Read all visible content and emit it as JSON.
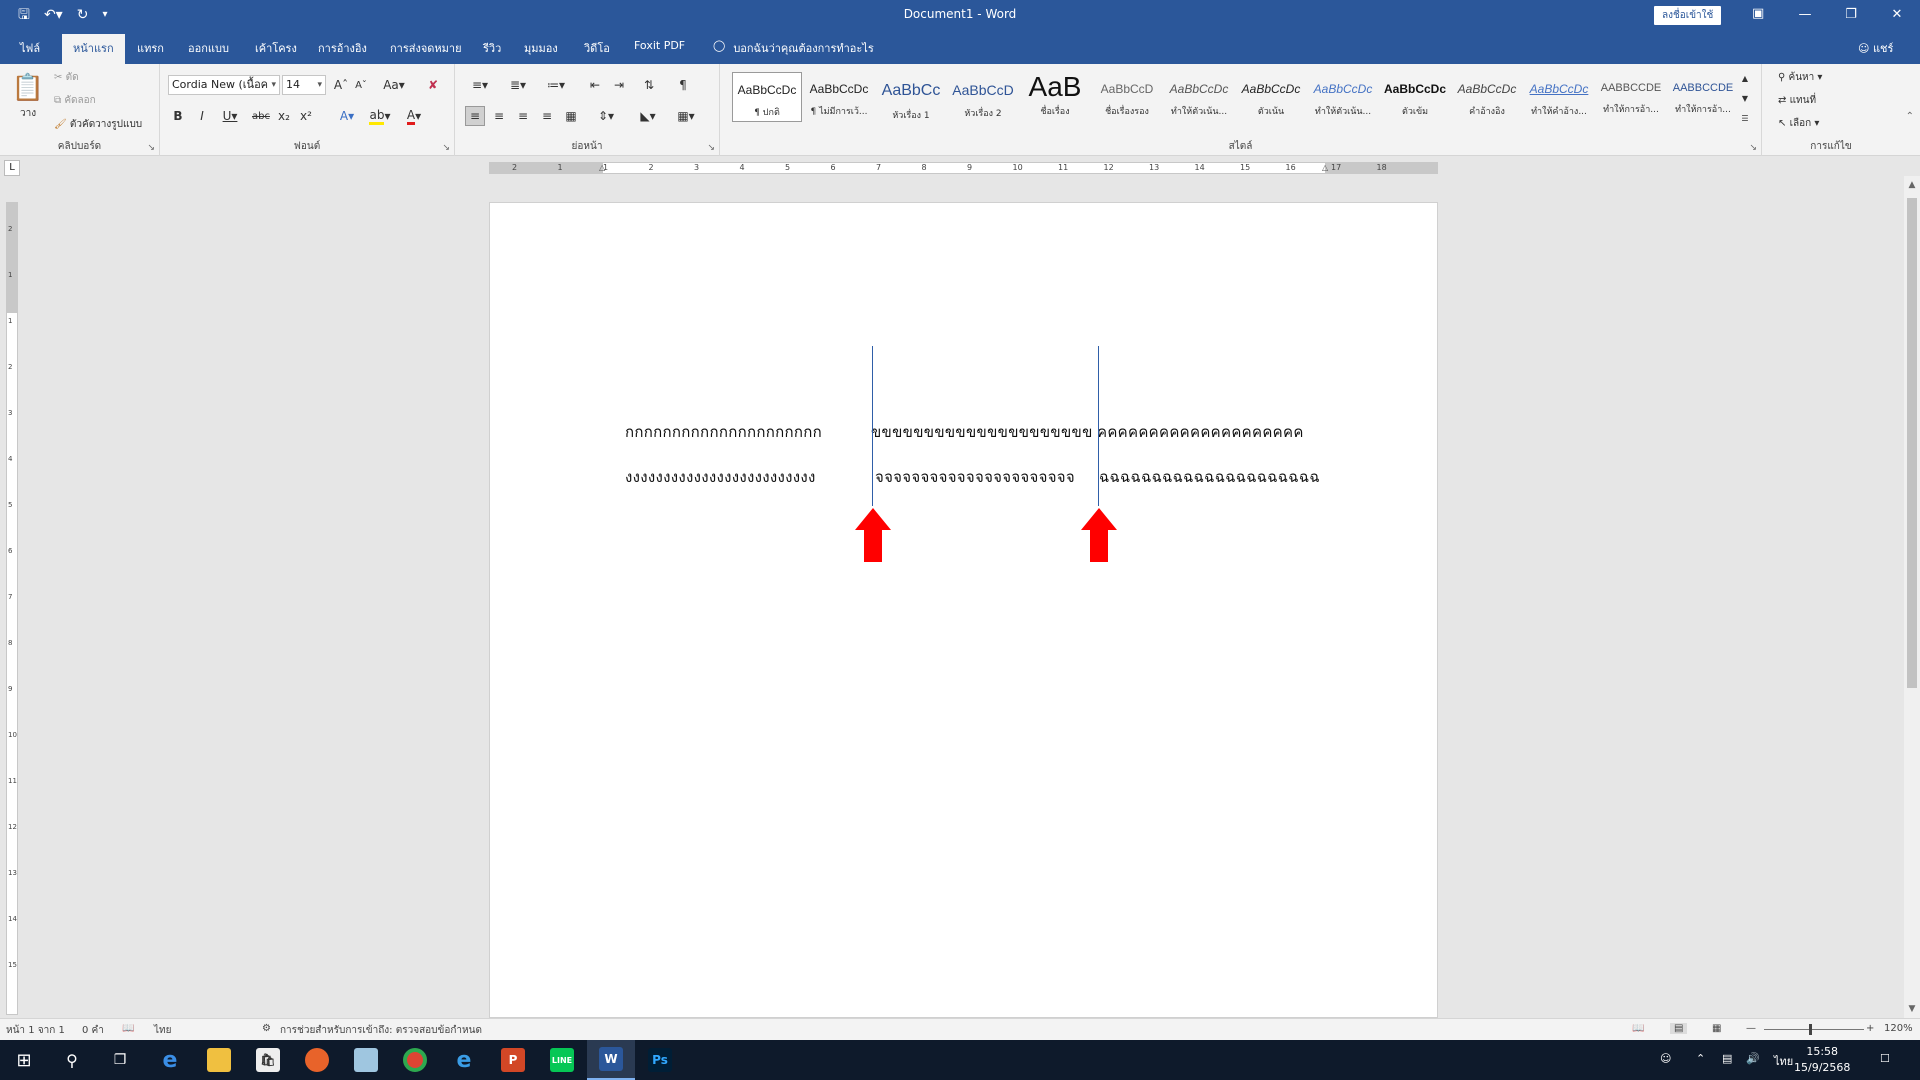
{
  "titlebar": {
    "title": "Document1 - Word",
    "signin": "ลงชื่อเข้าใช้",
    "qat": [
      "save-icon",
      "undo-icon",
      "redo-icon",
      "customize-icon"
    ]
  },
  "tabs": {
    "file": "ไฟล์",
    "home": "หน้าแรก",
    "insert": "แทรก",
    "design": "ออกแบบ",
    "layout": "เค้าโครง",
    "references": "การอ้างอิง",
    "mailings": "การส่งจดหมาย",
    "review": "รีวิว",
    "view": "มุมมอง",
    "video": "วิดีโอ",
    "foxit": "Foxit PDF",
    "tell_me": "บอกฉันว่าคุณต้องการทำอะไร",
    "share": "แชร์"
  },
  "ribbon": {
    "clipboard": {
      "label": "คลิปบอร์ด",
      "paste": "วาง",
      "cut": "ตัด",
      "copy": "คัดลอก",
      "format_painter": "ตัวคัดวางรูปแบบ"
    },
    "font": {
      "label": "ฟอนต์",
      "font_name": "Cordia New (เนื้อค",
      "font_size": "14"
    },
    "paragraph": {
      "label": "ย่อหน้า"
    },
    "styles": {
      "label": "สไตล์",
      "items": [
        {
          "preview": "AaBbCcDc",
          "name": "¶ ปกติ"
        },
        {
          "preview": "AaBbCcDc",
          "name": "¶ ไม่มีการเว้..."
        },
        {
          "preview": "AaBbCc",
          "name": "หัวเรื่อง 1"
        },
        {
          "preview": "AaBbCcD",
          "name": "หัวเรื่อง 2"
        },
        {
          "preview": "AaB",
          "name": "ชื่อเรื่อง"
        },
        {
          "preview": "AaBbCcD",
          "name": "ชื่อเรื่องรอง"
        },
        {
          "preview": "AaBbCcDc",
          "name": "ทำให้ตัวเน้น..."
        },
        {
          "preview": "AaBbCcDc",
          "name": "ตัวเน้น"
        },
        {
          "preview": "AaBbCcDc",
          "name": "ทำให้ตัวเน้น..."
        },
        {
          "preview": "AaBbCcDc",
          "name": "ตัวเข้ม"
        },
        {
          "preview": "AaBbCcDc",
          "name": "คำอ้างอิง"
        },
        {
          "preview": "AaBbCcDc",
          "name": "ทำให้คำอ้าง..."
        },
        {
          "preview": "AABBCCDE",
          "name": "ทำให้การอ้า..."
        },
        {
          "preview": "AABBCCDE",
          "name": "ทำให้การอ้า..."
        }
      ]
    },
    "editing": {
      "label": "การแก้ไข",
      "find": "ค้นหา",
      "replace": "แทนที่",
      "select": "เลือก"
    }
  },
  "document": {
    "line1": [
      "กกกกกกกกกกกกกกกกกกกกก",
      "ขขขขขขขขขขขขขขขขขขขขข",
      "คคคคคคคคคคคคคคคคคคคค"
    ],
    "line2": [
      "งงงงงงงงงงงงงงงงงงงงงงงงง",
      "จจจจจจจจจจจจจจจจจจจจจจ",
      "ฉฉฉฉฉฉฉฉฉฉฉฉฉฉฉฉฉฉฉฉฉ"
    ],
    "arrow_color": "#ff0000",
    "tab_line_color": "#2f5ea8"
  },
  "ruler": {
    "h_numbers": [
      "2",
      "1",
      "1",
      "2",
      "3",
      "4",
      "5",
      "6",
      "7",
      "8",
      "9",
      "10",
      "11",
      "12",
      "13",
      "14",
      "15",
      "16",
      "17",
      "18"
    ],
    "v_numbers": [
      "2",
      "1",
      "1",
      "2",
      "3",
      "4",
      "5",
      "6",
      "7",
      "8",
      "9",
      "10",
      "11",
      "12",
      "13",
      "14",
      "15"
    ]
  },
  "statusbar": {
    "page": "หน้า 1 จาก 1",
    "words": "0 คำ",
    "language": "ไทย",
    "accessibility": "การช่วยสำหรับการเข้าถึง: ตรวจสอบข้อกำหนด",
    "zoom": "120%"
  },
  "taskbar": {
    "apps": [
      "start-icon",
      "search-icon",
      "task-view-icon",
      "edge-icon",
      "file-explorer-icon",
      "store-icon",
      "firefox-icon",
      "notepad-icon",
      "chrome-icon",
      "ie-icon",
      "powerpoint-icon",
      "line-icon",
      "word-icon",
      "photoshop-icon"
    ],
    "language": "ไทย",
    "time": "15:58",
    "date": "15/9/2568"
  }
}
